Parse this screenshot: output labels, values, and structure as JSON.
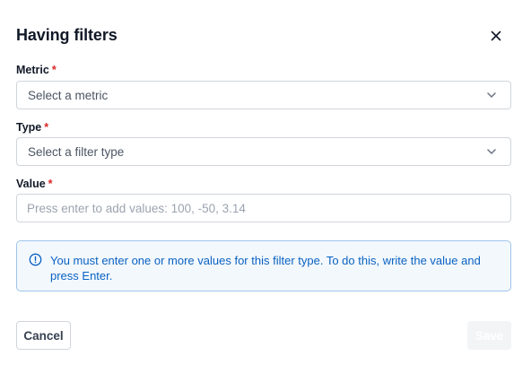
{
  "dialog": {
    "title": "Having filters",
    "close_icon": "close-icon"
  },
  "fields": {
    "metric": {
      "label": "Metric",
      "required_mark": "*",
      "placeholder": "Select a metric",
      "icon": "chevron-down-icon"
    },
    "type": {
      "label": "Type",
      "required_mark": "*",
      "placeholder": "Select a filter type",
      "icon": "chevron-down-icon"
    },
    "value": {
      "label": "Value",
      "required_mark": "*",
      "placeholder": "Press enter to add values: 100, -50, 3.14",
      "value": ""
    }
  },
  "alert": {
    "icon": "info-circle-icon",
    "message": "You must enter one or more values for this filter type. To do this, write the value and press Enter.",
    "color": "#0a62c2"
  },
  "footer": {
    "cancel_label": "Cancel",
    "save_label": "Save",
    "save_disabled": true
  },
  "colors": {
    "required": "#dc2626",
    "border": "#d1d5db",
    "alert_border": "#9ec5ea",
    "alert_bg": "#f3f8fd"
  }
}
